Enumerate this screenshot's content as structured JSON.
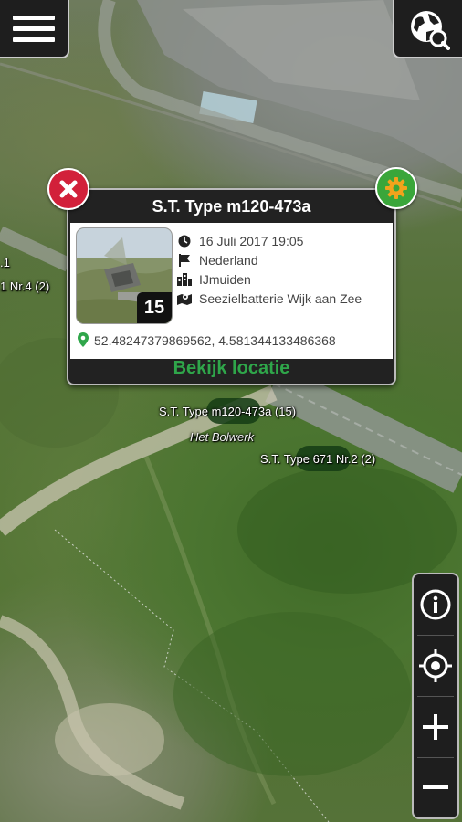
{
  "app": {
    "menu_icon": "hamburger-menu-icon",
    "search_icon": "globe-search-icon"
  },
  "map": {
    "labels": {
      "left_edge_1": ".1",
      "left_edge_2": "1 Nr.4 (2)",
      "marker_main": "S.T. Type m120-473a (15)",
      "place": "Het Bolwerk",
      "marker_second": "S.T. Type 671 Nr.2 (2)"
    }
  },
  "popup": {
    "title": "S.T. Type m120-473a",
    "photo_count": "15",
    "date": "16 Juli 2017 19:05",
    "country": "Nederland",
    "city": "IJmuiden",
    "group": "Seezielbatterie Wijk aan Zee",
    "coordinates": "52.48247379869562, 4.581344133486368",
    "action_label": "Bekijk locatie",
    "icons": {
      "date": "clock-icon",
      "country": "flag-icon",
      "city": "city-icon",
      "group": "map-marker-icon",
      "coordinates": "location-pin-icon"
    },
    "colors": {
      "action": "#2fa64a",
      "close": "#d2203a",
      "settings": "#3aa63a"
    }
  },
  "controls": {
    "items": [
      "info-icon",
      "locate-icon",
      "zoom-in-icon",
      "zoom-out-icon"
    ]
  }
}
